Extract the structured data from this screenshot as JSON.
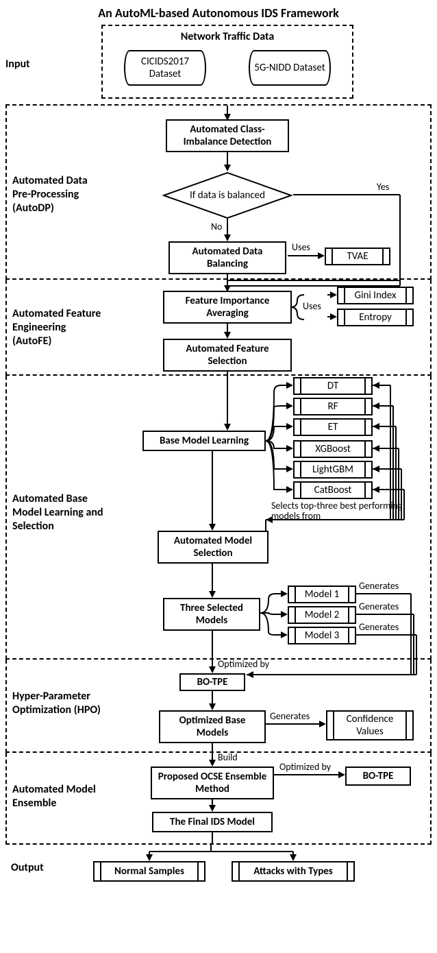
{
  "title": "An AutoML-based Autonomous IDS Framework",
  "input": {
    "label": "Input",
    "group_title": "Network Traffic Data",
    "datasets": [
      "CICIDS2017 Dataset",
      "5G-NIDD Dataset"
    ]
  },
  "autodp": {
    "label": "Automated Data Pre-Processing (AutoDP)",
    "detect": "Automated Class-Imbalance Detection",
    "decision": "If data is balanced",
    "yes": "Yes",
    "no": "No",
    "balance": "Automated Data Balancing",
    "uses": "Uses",
    "tvae": "TVAE"
  },
  "autofe": {
    "label": "Automated Feature Engineering (AutoFE)",
    "avg": "Feature Importance Averaging",
    "uses": "Uses",
    "gini": "Gini Index",
    "entropy": "Entropy",
    "select": "Automated Feature Selection"
  },
  "basemodel": {
    "label": "Automated Base Model Learning and Selection",
    "learn": "Base Model Learning",
    "models": [
      "DT",
      "RF",
      "ET",
      "XGBoost",
      "LightGBM",
      "CatBoost"
    ],
    "note": "Selects top-three best performing models from",
    "autosel": "Automated Model Selection",
    "three": "Three Selected Models",
    "selected": [
      "Model 1",
      "Model 2",
      "Model 3"
    ],
    "generates": "Generates"
  },
  "hpo": {
    "label": "Hyper-Parameter Optimization (HPO)",
    "optby": "Optimized by",
    "botpe": "BO-TPE",
    "optbase": "Optimized Base Models",
    "generates": "Generates",
    "conf": "Confidence Values"
  },
  "ensemble": {
    "label": "Automated Model Ensemble",
    "build": "Build",
    "ocse": "Proposed OCSE Ensemble Method",
    "optby": "Optimized by",
    "botpe": "BO-TPE",
    "final": "The Final IDS Model"
  },
  "output": {
    "label": "Output",
    "normal": "Normal Samples",
    "attacks": "Attacks with Types"
  }
}
